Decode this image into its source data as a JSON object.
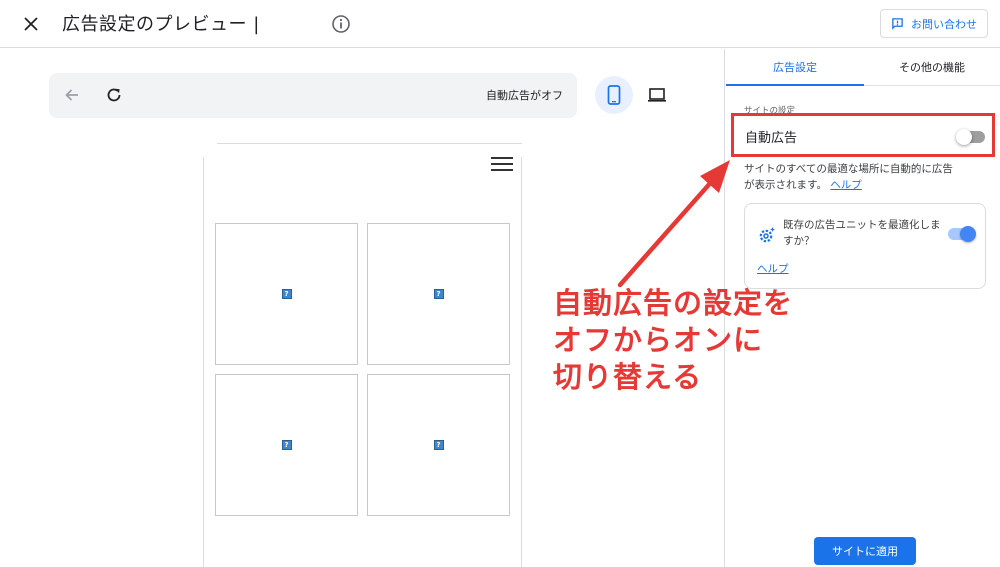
{
  "header": {
    "title": "広告設定のプレビュー |",
    "close_icon": "close-icon",
    "info_icon": "info-icon",
    "contact_label": "お問い合わせ"
  },
  "preview": {
    "auto_ads_status": "自動広告がオフ",
    "selected_device": "mobile",
    "ad_placeholder": "?"
  },
  "panel": {
    "tabs": [
      {
        "label": "広告設定",
        "active": true
      },
      {
        "label": "その他の機能",
        "active": false
      }
    ],
    "section_label": "サイトの設定",
    "auto_ads": {
      "label": "自動広告",
      "enabled": false,
      "description": "サイトのすべての最適な場所に自動的に広告が表示されます。",
      "help_label": "ヘルプ"
    },
    "optimize": {
      "text": "既存の広告ユニットを最適化しますか？",
      "enabled": true,
      "help_label": "ヘルプ"
    },
    "apply_label": "サイトに適用"
  },
  "annotation": {
    "lines": [
      "自動広告の設定を",
      "オフからオンに",
      "切り替える"
    ]
  },
  "colors": {
    "accent": "#1a73e8",
    "annotation_red": "#e53935",
    "toggle_off": "#9e9e9e",
    "toggle_on": "#4285f4"
  }
}
